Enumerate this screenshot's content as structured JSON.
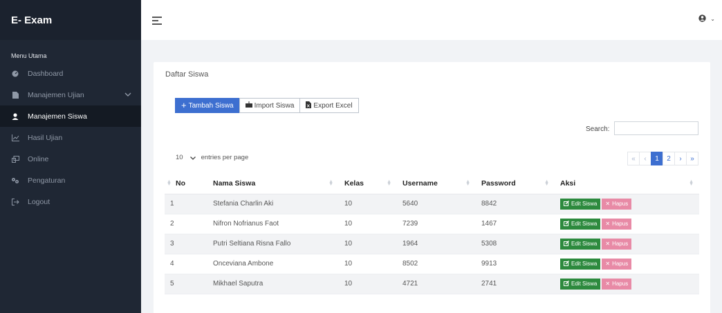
{
  "app": {
    "brand": "E- Exam"
  },
  "sidebar": {
    "section_label": "Menu Utama",
    "items": [
      {
        "label": "Dashboard",
        "icon": "dashboard-icon"
      },
      {
        "label": "Manajemen Ujian",
        "icon": "document-icon"
      },
      {
        "label": "Manajemen Siswa",
        "icon": "user-icon"
      },
      {
        "label": "Hasil Ujian",
        "icon": "chart-icon"
      },
      {
        "label": "Online",
        "icon": "online-icon"
      },
      {
        "label": "Pengaturan",
        "icon": "gear-icon"
      },
      {
        "label": "Logout",
        "icon": "logout-icon"
      }
    ]
  },
  "card": {
    "title": "Daftar Siswa",
    "buttons": {
      "add": "Tambah Siswa",
      "import": "Import Siswa",
      "export": "Export Excel"
    },
    "search_label": "Search:",
    "search_value": "",
    "per_page_value": "10",
    "per_page_label": "entries per page",
    "pagination": [
      "«",
      "‹",
      "1",
      "2",
      "›",
      "»"
    ],
    "columns": [
      "No",
      "Nama Siswa",
      "Kelas",
      "Username",
      "Password",
      "Aksi"
    ],
    "rows": [
      [
        "1",
        "Stefania Charlin Aki",
        "10",
        "5640",
        "8842"
      ],
      [
        "2",
        "Nifron Nofrianus Faot",
        "10",
        "7239",
        "1467"
      ],
      [
        "3",
        "Putri Seltiana Risna Fallo",
        "10",
        "1964",
        "5308"
      ],
      [
        "4",
        "Onceviana Ambone",
        "10",
        "8502",
        "9913"
      ],
      [
        "5",
        "Mikhael Saputra",
        "10",
        "4721",
        "2741"
      ]
    ],
    "edit_label": "Edit Siswa",
    "delete_label": "Hapus"
  },
  "colors": {
    "primary": "#3d6fd0",
    "sidebar": "#1f2734",
    "edit": "#2d8a3e",
    "delete": "#e88aa6"
  }
}
